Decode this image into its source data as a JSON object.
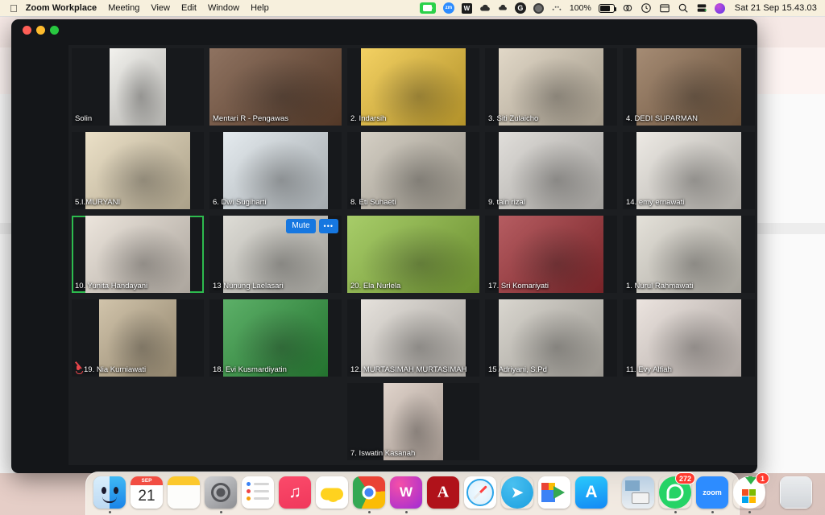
{
  "menubar": {
    "apple_icon": "apple-logo-icon",
    "items": [
      {
        "label": "Zoom Workplace",
        "bold": true
      },
      {
        "label": "Meeting",
        "bold": false
      },
      {
        "label": "View",
        "bold": false
      },
      {
        "label": "Edit",
        "bold": false
      },
      {
        "label": "Window",
        "bold": false
      },
      {
        "label": "Help",
        "bold": false
      }
    ],
    "status_icons": [
      "screen-record-green-icon",
      "zoom-blue-icon",
      "wps-writer-icon",
      "cloud-filled-icon",
      "cloud-small-icon",
      "grammarly-icon",
      "circle-gray-icon",
      "dots-pattern-icon"
    ],
    "battery_percent": "100%",
    "right_icons": [
      "battery-icon",
      "screen-mirroring-icon",
      "control-center-icon",
      "calendar-icon",
      "spotlight-search-icon",
      "display-settings-icon",
      "siri-icon"
    ],
    "clock": "Sat 21 Sep  15.43.03"
  },
  "window": {
    "traffic_lights": [
      "close",
      "minimize",
      "zoom"
    ],
    "app": "Zoom Workplace"
  },
  "gallery": {
    "selected_participant": "10. Yunita Handayani",
    "hover_actions": {
      "mute_label": "Mute",
      "more_label": "•••"
    },
    "rows": [
      [
        {
          "name": "Solin",
          "vw": 70,
          "vx": 49,
          "bg": "#efeee9",
          "muted": false,
          "sel": false,
          "label_outside": true
        },
        {
          "name": "Mentari R - Pengawas",
          "vw": 164,
          "vx": 0,
          "bg": "#6f4b34",
          "muted": false,
          "sel": false
        },
        {
          "name": "2. Indarsih",
          "vw": 130,
          "vx": 17,
          "bg": "#f0c437",
          "muted": false,
          "sel": false
        },
        {
          "name": "3. Siti Zulaicho",
          "vw": 130,
          "vx": 17,
          "bg": "#d9cdb8",
          "muted": false,
          "sel": false
        },
        {
          "name": "4. DEDI SUPARMAN",
          "vw": 130,
          "vx": 17,
          "bg": "#8c6b4d",
          "muted": false,
          "sel": false
        }
      ],
      [
        {
          "name": "5.I.MURYANI",
          "vw": 130,
          "vx": 17,
          "bg": "#e6d8b8",
          "muted": false,
          "sel": false
        },
        {
          "name": "6. Dwi Sugiharti",
          "vw": 130,
          "vx": 17,
          "bg": "#dde5ea",
          "muted": false,
          "sel": false
        },
        {
          "name": "8. Eti Suhaeti",
          "vw": 130,
          "vx": 17,
          "bg": "#c9c2b4",
          "muted": false,
          "sel": false
        },
        {
          "name": "9. tain rizal",
          "vw": 130,
          "vx": 17,
          "bg": "#d8d5d0",
          "muted": false,
          "sel": false
        },
        {
          "name": "14. emy ernawati",
          "vw": 130,
          "vx": 17,
          "bg": "#e8e4dd",
          "muted": false,
          "sel": false
        }
      ],
      [
        {
          "name": "10. Yunita Handayani",
          "vw": 130,
          "vx": 17,
          "bg": "#e7ded3",
          "muted": false,
          "sel": true
        },
        {
          "name": "13 Nunung Laelasari",
          "vw": 130,
          "vx": 17,
          "bg": "#d5d3cb",
          "muted": false,
          "sel": false,
          "actions": true
        },
        {
          "name": "20. Ela Nurlela",
          "vw": 164,
          "vx": 0,
          "bg": "#8fbf3f",
          "muted": false,
          "sel": false
        },
        {
          "name": "17. Sri Komariyati",
          "vw": 130,
          "vx": 17,
          "bg": "#a12f35",
          "muted": false,
          "sel": false
        },
        {
          "name": "1. Nurul Rahmawati",
          "vw": 130,
          "vx": 17,
          "bg": "#ddd9cf",
          "muted": false,
          "sel": false
        }
      ],
      [
        {
          "name": "19. Nia Kurniawati",
          "vw": 96,
          "vx": 34,
          "bg": "#c4b393",
          "muted": true,
          "sel": false
        },
        {
          "name": "18. Evi Kusmardiyatin",
          "vw": 130,
          "vx": 17,
          "bg": "#2f9a3e",
          "muted": false,
          "sel": false
        },
        {
          "name": "12. MURTASIMAH MURTASIMAH",
          "vw": 130,
          "vx": 17,
          "bg": "#ded9d2",
          "muted": false,
          "sel": false
        },
        {
          "name": "15 Adriyani, S.Pd",
          "vw": 130,
          "vx": 17,
          "bg": "#cfcbc2",
          "muted": false,
          "sel": false
        },
        {
          "name": "11. Evy Alfiah",
          "vw": 130,
          "vx": 17,
          "bg": "#e6dcd6",
          "muted": false,
          "sel": false
        }
      ],
      [
        {
          "name": "7. Iswatin Kasanah",
          "vw": 74,
          "vx": 45,
          "bg": "#d8c8bd",
          "muted": false,
          "sel": false,
          "col": 2
        }
      ]
    ]
  },
  "dock": {
    "items": [
      {
        "name": "finder",
        "badge": null,
        "running": true
      },
      {
        "name": "calendar",
        "badge": null,
        "running": false,
        "month": "SEP",
        "day": "21"
      },
      {
        "name": "notes",
        "badge": null,
        "running": false
      },
      {
        "name": "system-settings",
        "badge": null,
        "running": true
      },
      {
        "name": "reminders",
        "badge": null,
        "running": false
      },
      {
        "name": "music",
        "badge": null,
        "running": false
      },
      {
        "name": "weather",
        "badge": null,
        "running": false
      },
      {
        "name": "google-chrome",
        "badge": null,
        "running": true
      },
      {
        "name": "wps-office",
        "badge": null,
        "running": true
      },
      {
        "name": "adobe-acrobat",
        "badge": null,
        "running": false
      },
      {
        "name": "safari",
        "badge": null,
        "running": false
      },
      {
        "name": "telegram",
        "badge": null,
        "running": false
      },
      {
        "name": "google-meet",
        "badge": null,
        "running": false
      },
      {
        "name": "app-store",
        "badge": null,
        "running": false
      },
      {
        "separator": true
      },
      {
        "name": "image-capture-downloads",
        "badge": null,
        "running": false
      },
      {
        "name": "whatsapp",
        "badge": "272",
        "running": true
      },
      {
        "name": "zoom",
        "badge": null,
        "running": true,
        "label": "zoom"
      },
      {
        "name": "microsoft-office-installer",
        "badge": "1",
        "running": true
      },
      {
        "separator": true
      },
      {
        "name": "trash",
        "badge": null,
        "running": false
      }
    ]
  }
}
